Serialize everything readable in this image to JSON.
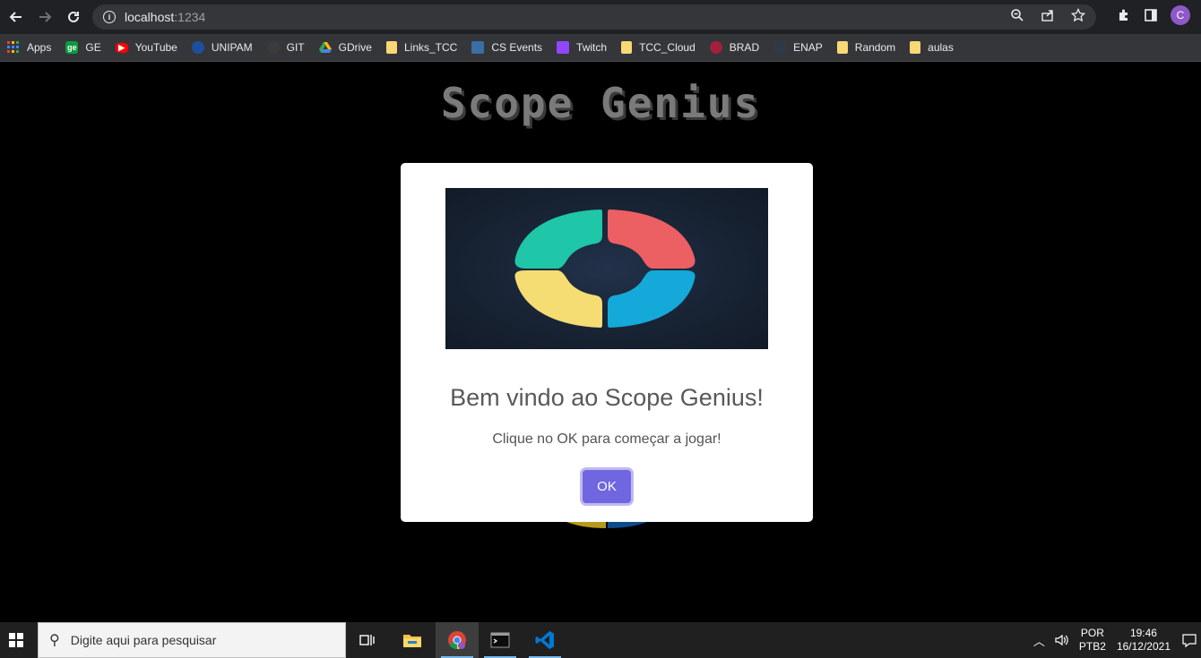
{
  "browser": {
    "url_host": "localhost",
    "url_port": ":1234",
    "profile_initial": "C"
  },
  "bookmarks": [
    {
      "label": "Apps",
      "icon": "apps-grid-icon"
    },
    {
      "label": "GE",
      "icon": "ge-icon"
    },
    {
      "label": "YouTube",
      "icon": "youtube-icon"
    },
    {
      "label": "UNIPAM",
      "icon": "unipam-icon"
    },
    {
      "label": "GIT",
      "icon": "github-icon"
    },
    {
      "label": "GDrive",
      "icon": "gdrive-icon"
    },
    {
      "label": "Links_TCC",
      "icon": "folder-icon"
    },
    {
      "label": "CS Events",
      "icon": "cs-events-icon"
    },
    {
      "label": "Twitch",
      "icon": "twitch-icon"
    },
    {
      "label": "TCC_Cloud",
      "icon": "folder-icon"
    },
    {
      "label": "BRAD",
      "icon": "brad-icon"
    },
    {
      "label": "ENAP",
      "icon": "enap-icon"
    },
    {
      "label": "Random",
      "icon": "folder-icon"
    },
    {
      "label": "aulas",
      "icon": "folder-icon"
    }
  ],
  "page": {
    "title": "Scope Genius"
  },
  "modal": {
    "title": "Bem vindo ao Scope Genius!",
    "text": "Clique no OK para começar a jogar!",
    "ok_label": "OK"
  },
  "taskbar": {
    "search_placeholder": "Digite aqui para pesquisar",
    "lang_line1": "POR",
    "lang_line2": "PTB2",
    "time": "19:46",
    "date": "16/12/2021"
  },
  "colors": {
    "genius_green": "#1fc6a8",
    "genius_red": "#ec5f63",
    "genius_yellow": "#f6dd73",
    "genius_blue": "#14a9d9",
    "ok_button": "#7066e0"
  }
}
